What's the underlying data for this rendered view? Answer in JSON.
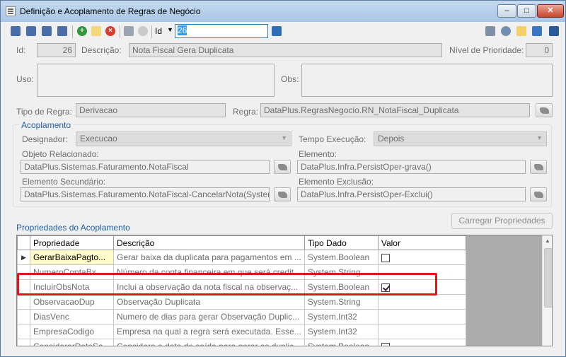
{
  "window": {
    "title": "Definição e Acoplamento de Regras de Negócio"
  },
  "toolbar": {
    "id_label": "Id",
    "id_value": "26"
  },
  "header": {
    "id_label": "Id:",
    "id_value": "26",
    "descricao_label": "Descrição:",
    "descricao_value": "Nota Fiscal Gera Duplicata",
    "nivel_label": "Nível de Prioridade:",
    "nivel_value": "0",
    "uso_label": "Uso:",
    "obs_label": "Obs:",
    "tipo_label": "Tipo de Regra:",
    "tipo_value": "Derivacao",
    "regra_label": "Regra:",
    "regra_value": "DataPlus.RegrasNegocio.RN_NotaFiscal_Duplicata"
  },
  "acoplamento": {
    "title": "Acoplamento",
    "designador_label": "Designador:",
    "designador_value": "Execucao",
    "tempo_label": "Tempo Execução:",
    "tempo_value": "Depois",
    "objeto_label": "Objeto Relacionado:",
    "objeto_value": "DataPlus.Sistemas.Faturamento.NotaFiscal",
    "elemento_label": "Elemento:",
    "elemento_value": "DataPlus.Infra.PersistOper-grava()",
    "secundario_label": "Elemento Secundário:",
    "secundario_value": "DataPlus.Sistemas.Faturamento.NotaFiscal-CancelarNota(System",
    "exclusao_label": "Elemento Exclusão:",
    "exclusao_value": "DataPlus.Infra.PersistOper-Exclui()"
  },
  "propriedades": {
    "title": "Propriedades do Acoplamento",
    "load_button": "Carregar Propriedades",
    "columns": [
      "Propriedade",
      "Descrição",
      "Tipo Dado",
      "Valor"
    ],
    "rows": [
      {
        "prop": "GerarBaixaPagto...",
        "desc": "Gerar baixa da duplicata para pagamentos em ...",
        "tipo": "System.Boolean",
        "valor": "unchecked"
      },
      {
        "prop": "NumeroContaBx",
        "desc": "Número da conta financeira em que será credit...",
        "tipo": "System.String",
        "valor": ""
      },
      {
        "prop": "IncluirObsNota",
        "desc": "Inclui a observação da nota fiscal na observaç...",
        "tipo": "System.Boolean",
        "valor": "checked"
      },
      {
        "prop": "ObservacaoDup",
        "desc": "Observação Duplicata",
        "tipo": "System.String",
        "valor": ""
      },
      {
        "prop": "DiasVenc",
        "desc": "Numero de dias para gerar Observação Duplic...",
        "tipo": "System.Int32",
        "valor": ""
      },
      {
        "prop": "EmpresaCodigo",
        "desc": "Empresa na qual a regra será executada. Esse...",
        "tipo": "System.Int32",
        "valor": ""
      },
      {
        "prop": "ConsiderarDataSa...",
        "desc": "Considera a data de saída para gerar as duplic...",
        "tipo": "System.Boolean",
        "valor": "unchecked"
      }
    ]
  },
  "colors": {
    "accent": "#1f5fa6",
    "highlight": "#e0141c",
    "selected_cell": "#fffbc8"
  }
}
